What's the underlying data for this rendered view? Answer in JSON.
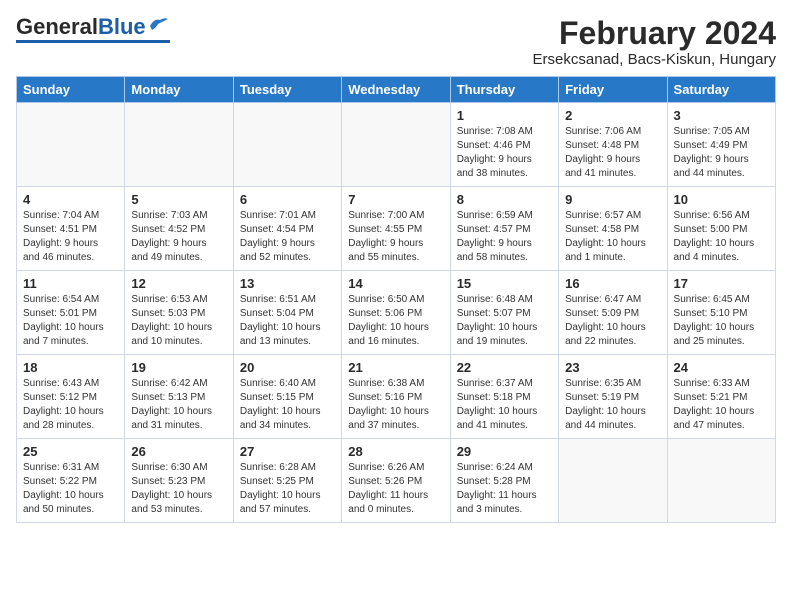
{
  "header": {
    "logo_general": "General",
    "logo_blue": "Blue",
    "month_title": "February 2024",
    "location": "Ersekcsanad, Bacs-Kiskun, Hungary"
  },
  "weekdays": [
    "Sunday",
    "Monday",
    "Tuesday",
    "Wednesday",
    "Thursday",
    "Friday",
    "Saturday"
  ],
  "weeks": [
    [
      {
        "day": "",
        "detail": ""
      },
      {
        "day": "",
        "detail": ""
      },
      {
        "day": "",
        "detail": ""
      },
      {
        "day": "",
        "detail": ""
      },
      {
        "day": "1",
        "detail": "Sunrise: 7:08 AM\nSunset: 4:46 PM\nDaylight: 9 hours\nand 38 minutes."
      },
      {
        "day": "2",
        "detail": "Sunrise: 7:06 AM\nSunset: 4:48 PM\nDaylight: 9 hours\nand 41 minutes."
      },
      {
        "day": "3",
        "detail": "Sunrise: 7:05 AM\nSunset: 4:49 PM\nDaylight: 9 hours\nand 44 minutes."
      }
    ],
    [
      {
        "day": "4",
        "detail": "Sunrise: 7:04 AM\nSunset: 4:51 PM\nDaylight: 9 hours\nand 46 minutes."
      },
      {
        "day": "5",
        "detail": "Sunrise: 7:03 AM\nSunset: 4:52 PM\nDaylight: 9 hours\nand 49 minutes."
      },
      {
        "day": "6",
        "detail": "Sunrise: 7:01 AM\nSunset: 4:54 PM\nDaylight: 9 hours\nand 52 minutes."
      },
      {
        "day": "7",
        "detail": "Sunrise: 7:00 AM\nSunset: 4:55 PM\nDaylight: 9 hours\nand 55 minutes."
      },
      {
        "day": "8",
        "detail": "Sunrise: 6:59 AM\nSunset: 4:57 PM\nDaylight: 9 hours\nand 58 minutes."
      },
      {
        "day": "9",
        "detail": "Sunrise: 6:57 AM\nSunset: 4:58 PM\nDaylight: 10 hours\nand 1 minute."
      },
      {
        "day": "10",
        "detail": "Sunrise: 6:56 AM\nSunset: 5:00 PM\nDaylight: 10 hours\nand 4 minutes."
      }
    ],
    [
      {
        "day": "11",
        "detail": "Sunrise: 6:54 AM\nSunset: 5:01 PM\nDaylight: 10 hours\nand 7 minutes."
      },
      {
        "day": "12",
        "detail": "Sunrise: 6:53 AM\nSunset: 5:03 PM\nDaylight: 10 hours\nand 10 minutes."
      },
      {
        "day": "13",
        "detail": "Sunrise: 6:51 AM\nSunset: 5:04 PM\nDaylight: 10 hours\nand 13 minutes."
      },
      {
        "day": "14",
        "detail": "Sunrise: 6:50 AM\nSunset: 5:06 PM\nDaylight: 10 hours\nand 16 minutes."
      },
      {
        "day": "15",
        "detail": "Sunrise: 6:48 AM\nSunset: 5:07 PM\nDaylight: 10 hours\nand 19 minutes."
      },
      {
        "day": "16",
        "detail": "Sunrise: 6:47 AM\nSunset: 5:09 PM\nDaylight: 10 hours\nand 22 minutes."
      },
      {
        "day": "17",
        "detail": "Sunrise: 6:45 AM\nSunset: 5:10 PM\nDaylight: 10 hours\nand 25 minutes."
      }
    ],
    [
      {
        "day": "18",
        "detail": "Sunrise: 6:43 AM\nSunset: 5:12 PM\nDaylight: 10 hours\nand 28 minutes."
      },
      {
        "day": "19",
        "detail": "Sunrise: 6:42 AM\nSunset: 5:13 PM\nDaylight: 10 hours\nand 31 minutes."
      },
      {
        "day": "20",
        "detail": "Sunrise: 6:40 AM\nSunset: 5:15 PM\nDaylight: 10 hours\nand 34 minutes."
      },
      {
        "day": "21",
        "detail": "Sunrise: 6:38 AM\nSunset: 5:16 PM\nDaylight: 10 hours\nand 37 minutes."
      },
      {
        "day": "22",
        "detail": "Sunrise: 6:37 AM\nSunset: 5:18 PM\nDaylight: 10 hours\nand 41 minutes."
      },
      {
        "day": "23",
        "detail": "Sunrise: 6:35 AM\nSunset: 5:19 PM\nDaylight: 10 hours\nand 44 minutes."
      },
      {
        "day": "24",
        "detail": "Sunrise: 6:33 AM\nSunset: 5:21 PM\nDaylight: 10 hours\nand 47 minutes."
      }
    ],
    [
      {
        "day": "25",
        "detail": "Sunrise: 6:31 AM\nSunset: 5:22 PM\nDaylight: 10 hours\nand 50 minutes."
      },
      {
        "day": "26",
        "detail": "Sunrise: 6:30 AM\nSunset: 5:23 PM\nDaylight: 10 hours\nand 53 minutes."
      },
      {
        "day": "27",
        "detail": "Sunrise: 6:28 AM\nSunset: 5:25 PM\nDaylight: 10 hours\nand 57 minutes."
      },
      {
        "day": "28",
        "detail": "Sunrise: 6:26 AM\nSunset: 5:26 PM\nDaylight: 11 hours\nand 0 minutes."
      },
      {
        "day": "29",
        "detail": "Sunrise: 6:24 AM\nSunset: 5:28 PM\nDaylight: 11 hours\nand 3 minutes."
      },
      {
        "day": "",
        "detail": ""
      },
      {
        "day": "",
        "detail": ""
      }
    ]
  ]
}
